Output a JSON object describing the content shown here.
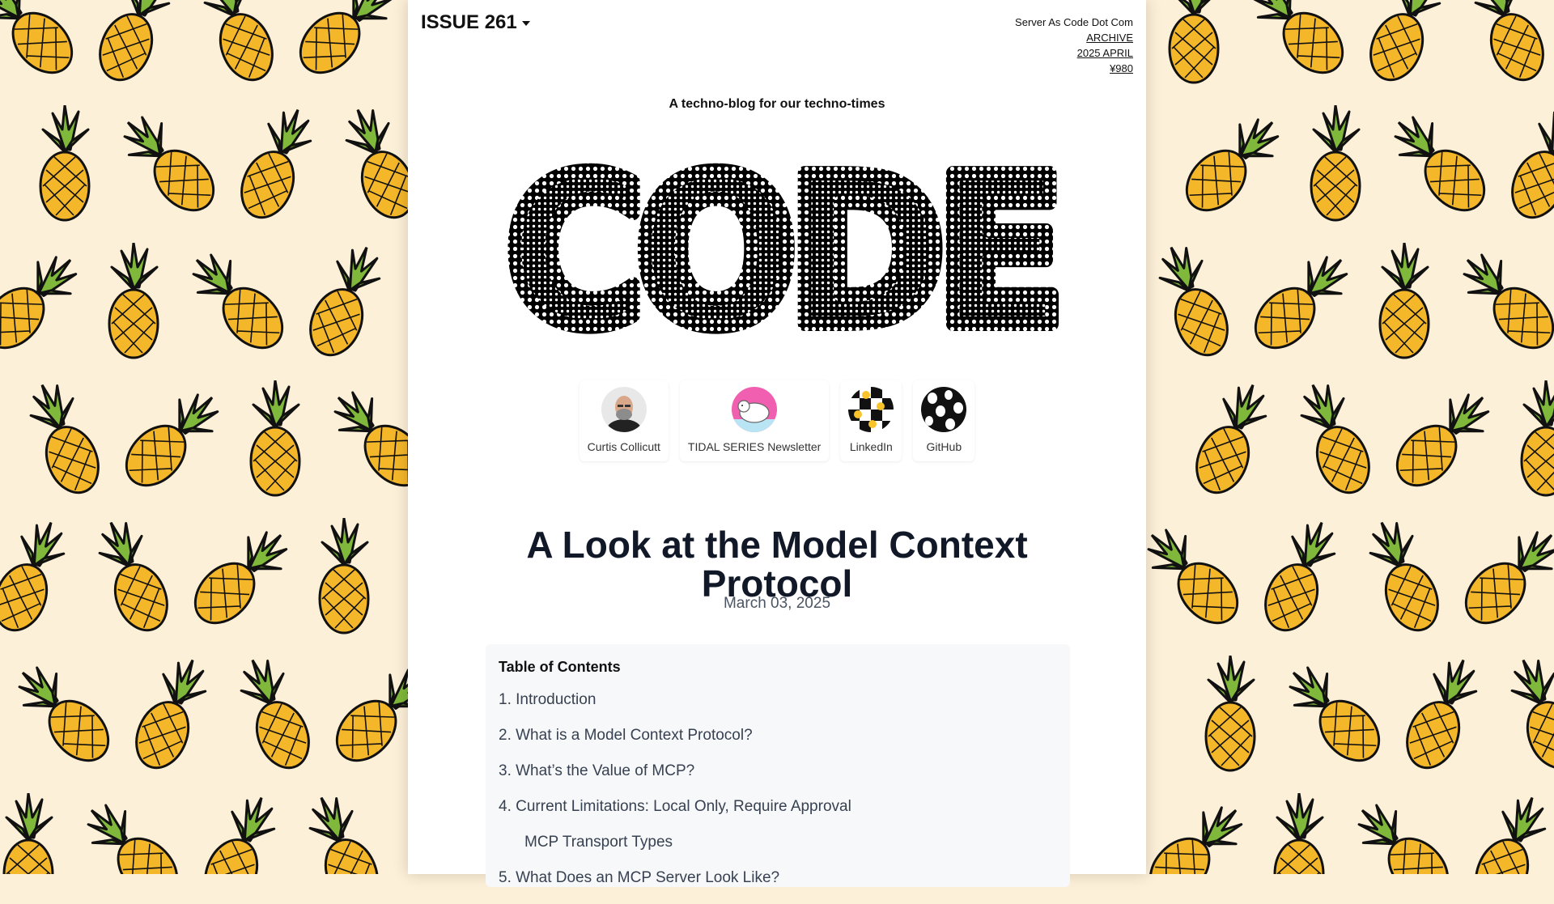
{
  "header": {
    "issue_label": "ISSUE 261",
    "site_name": "Server As Code Dot Com",
    "archive_link": "ARCHIVE",
    "edition_link": "2025 APRIL",
    "price_link": "¥980"
  },
  "tagline": "A techno-blog for our techno-times",
  "logo_text": "CODE",
  "links": [
    {
      "label": "Curtis Collicutt",
      "icon": "person-avatar"
    },
    {
      "label": "TIDAL SERIES Newsletter",
      "icon": "polar-bear-avatar"
    },
    {
      "label": "LinkedIn",
      "icon": "checkered-smiley-avatar"
    },
    {
      "label": "GitHub",
      "icon": "ghost-pattern-avatar"
    }
  ],
  "article": {
    "title": "A Look at the Model Context Protocol",
    "date": "March 03, 2025"
  },
  "toc": {
    "title": "Table of Contents",
    "items": [
      "1. Introduction",
      "2. What is a Model Context Protocol?",
      "3. What’s the Value of MCP?",
      "4. Current Limitations: Local Only, Require Approval",
      "MCP Transport Types",
      "5. What Does an MCP Server Look Like?"
    ]
  },
  "colors": {
    "background": "#fdf0d8",
    "pineapple_body": "#f5b72a",
    "pineapple_leaves": "#7fb83a",
    "paper": "#ffffff",
    "toc_background": "#f7f8f9"
  }
}
